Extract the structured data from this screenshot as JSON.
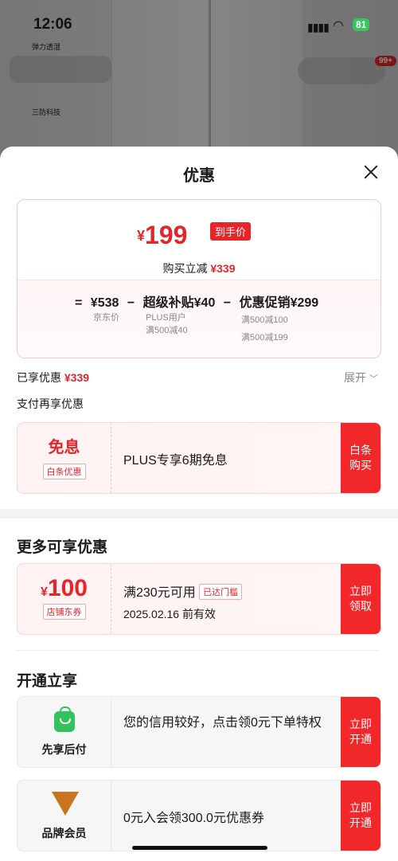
{
  "status_bar": {
    "time": "12:06",
    "battery": "81"
  },
  "background": {
    "badge1_text": "弹力透湿",
    "badge2_text": "三防科技",
    "cart_count": "99+"
  },
  "sheet": {
    "title": "优惠",
    "price_card": {
      "currency": "¥",
      "final_price": "199",
      "final_tag": "到手价",
      "cut_label": "购买立减",
      "cut_value": "¥339",
      "formula": {
        "eq": "=",
        "jd_price": "¥538",
        "minus1": "−",
        "subsidy": "超级补贴¥40",
        "minus2": "−",
        "promo": "优惠促销¥299"
      },
      "sub_jd": "京东价",
      "sub_plus_1": "PLUS用户",
      "sub_plus_2": "满500减40",
      "sub_promo_1": "满500减100",
      "sub_promo_2": "满500减199"
    },
    "enjoyed_label": "已享优惠",
    "enjoyed_value": "¥339",
    "expand_label": "展开",
    "pay_section_title": "支付再享优惠",
    "baitiao": {
      "title": "免息",
      "tag": "白条优惠",
      "desc": "PLUS专享6期免息",
      "action_1": "白条",
      "action_2": "购买"
    },
    "more_section_title": "更多可享优惠",
    "coupon": {
      "currency": "¥",
      "amount": "100",
      "tag": "店铺东券",
      "condition": "满230元可用",
      "status_tag": "已达门槛",
      "expiry": "2025.02.16 前有效",
      "action_1": "立即",
      "action_2": "领取"
    },
    "open_section_title": "开通立享",
    "credit": {
      "name": "先享后付",
      "desc": "您的信用较好，点击领0元下单特权",
      "action_1": "立即",
      "action_2": "开通"
    },
    "member": {
      "name": "品牌会员",
      "desc": "0元入会领300.0元优惠券",
      "action_1": "立即",
      "action_2": "开通"
    }
  }
}
